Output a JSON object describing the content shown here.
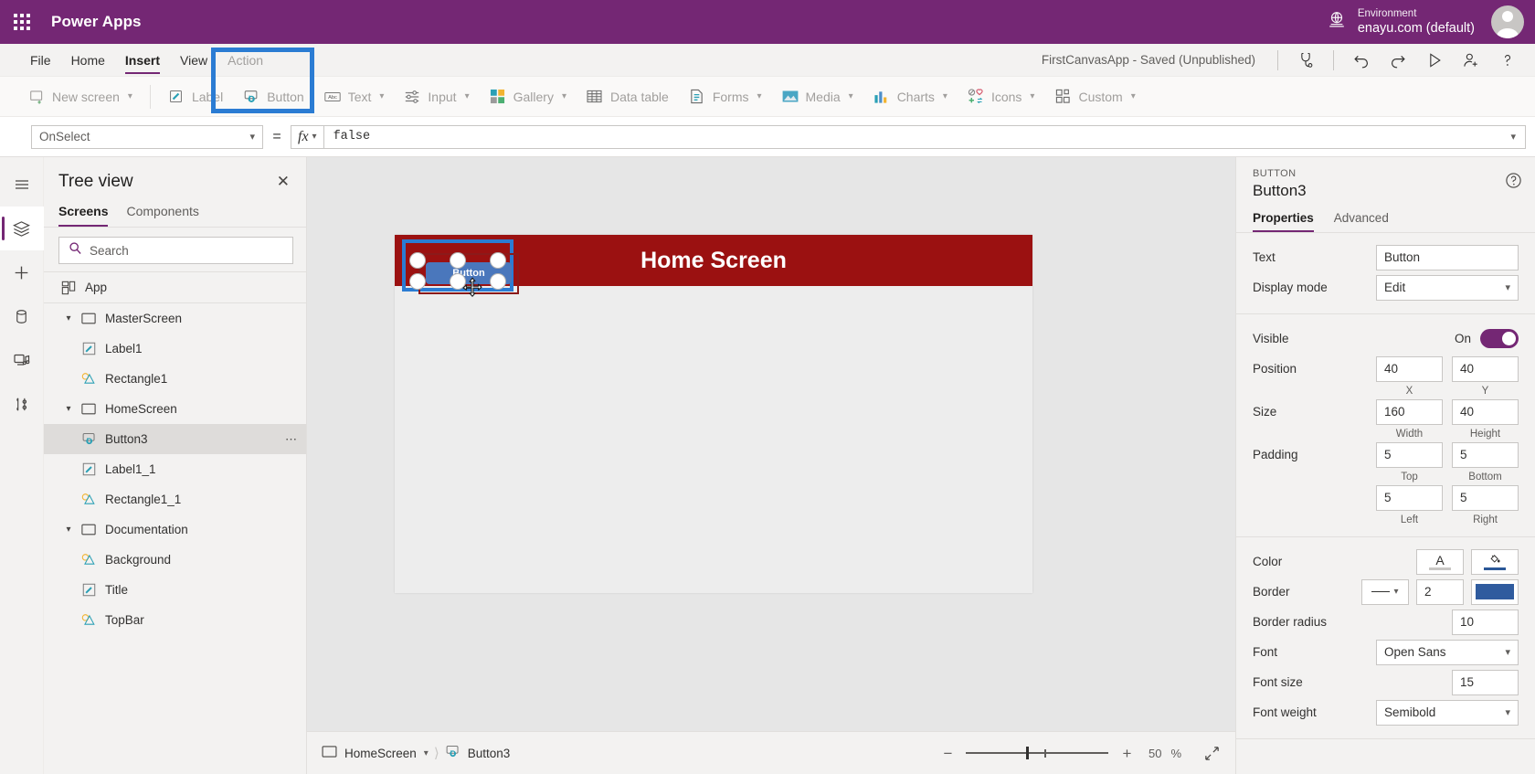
{
  "suite": {
    "waffle_icon": "waffle-icon",
    "brand": "Power Apps",
    "globe_icon": "globe-icon",
    "environment_label": "Environment",
    "environment_value": "enayu.com (default)",
    "avatar_icon": "avatar"
  },
  "menu": {
    "items": [
      {
        "label": "File",
        "active": false,
        "dim": false
      },
      {
        "label": "Home",
        "active": false,
        "dim": false
      },
      {
        "label": "Insert",
        "active": true,
        "dim": false
      },
      {
        "label": "View",
        "active": false,
        "dim": false
      },
      {
        "label": "Action",
        "active": false,
        "dim": true
      }
    ],
    "saved_status": "FirstCanvasApp - Saved (Unpublished)",
    "commands": [
      {
        "name": "app-checker-icon",
        "title": "App checker"
      },
      {
        "name": "undo-icon",
        "title": "Undo"
      },
      {
        "name": "redo-icon",
        "title": "Redo"
      },
      {
        "name": "preview-icon",
        "title": "Preview the app"
      },
      {
        "name": "share-icon",
        "title": "Share"
      },
      {
        "name": "help-icon",
        "title": "Help"
      }
    ]
  },
  "ribbon": {
    "items": [
      {
        "label": "New screen",
        "icon": "new-screen-icon",
        "caret": true
      },
      {
        "label": "Label",
        "icon": "label-icon",
        "caret": false
      },
      {
        "label": "Button",
        "icon": "button-icon",
        "caret": false
      },
      {
        "label": "Text",
        "icon": "text-icon",
        "caret": true
      },
      {
        "label": "Input",
        "icon": "input-icon",
        "caret": true
      },
      {
        "label": "Gallery",
        "icon": "gallery-icon",
        "caret": true
      },
      {
        "label": "Data table",
        "icon": "data-table-icon",
        "caret": false
      },
      {
        "label": "Forms",
        "icon": "forms-icon",
        "caret": true
      },
      {
        "label": "Media",
        "icon": "media-icon",
        "caret": true
      },
      {
        "label": "Charts",
        "icon": "charts-icon",
        "caret": true
      },
      {
        "label": "Icons",
        "icon": "icons-icon",
        "caret": true
      },
      {
        "label": "Custom",
        "icon": "custom-icon",
        "caret": true
      }
    ],
    "highlight_color": "#2b7cd3"
  },
  "formula": {
    "property": "OnSelect",
    "equals": "=",
    "fx_label": "fx",
    "value": "false"
  },
  "rail": {
    "items": [
      {
        "name": "hamburger-icon",
        "selected": false
      },
      {
        "name": "tree-view-icon",
        "selected": true
      },
      {
        "name": "insert-icon",
        "selected": false
      },
      {
        "name": "data-icon",
        "selected": false
      },
      {
        "name": "media-icon",
        "selected": false
      },
      {
        "name": "advanced-tools-icon",
        "selected": false
      }
    ]
  },
  "tree": {
    "title": "Tree view",
    "close_icon": "close-icon",
    "tabs": [
      {
        "label": "Screens",
        "active": true
      },
      {
        "label": "Components",
        "active": false
      }
    ],
    "search_placeholder": "Search",
    "search_icon": "search-icon",
    "app_label": "App",
    "app_icon": "app-icon",
    "nodes": [
      {
        "label": "MasterScreen",
        "icon": "screen-icon",
        "indent": 0,
        "caret": "expanded",
        "selected": false,
        "menu": false
      },
      {
        "label": "Label1",
        "icon": "label-icon",
        "indent": 1,
        "caret": "none",
        "selected": false,
        "menu": false
      },
      {
        "label": "Rectangle1",
        "icon": "shape-icon",
        "indent": 1,
        "caret": "none",
        "selected": false,
        "menu": false
      },
      {
        "label": "HomeScreen",
        "icon": "screen-icon",
        "indent": 0,
        "caret": "expanded",
        "selected": false,
        "menu": false
      },
      {
        "label": "Button3",
        "icon": "button-icon",
        "indent": 1,
        "caret": "none",
        "selected": true,
        "menu": true
      },
      {
        "label": "Label1_1",
        "icon": "label-icon",
        "indent": 1,
        "caret": "none",
        "selected": false,
        "menu": false
      },
      {
        "label": "Rectangle1_1",
        "icon": "shape-icon",
        "indent": 1,
        "caret": "none",
        "selected": false,
        "menu": false
      },
      {
        "label": "Documentation",
        "icon": "screen-icon",
        "indent": 0,
        "caret": "expanded",
        "selected": false,
        "menu": false
      },
      {
        "label": "Background",
        "icon": "shape-icon",
        "indent": 1,
        "caret": "none",
        "selected": false,
        "menu": false
      },
      {
        "label": "Title",
        "icon": "label-icon",
        "indent": 1,
        "caret": "none",
        "selected": false,
        "menu": false
      },
      {
        "label": "TopBar",
        "icon": "shape-icon",
        "indent": 1,
        "caret": "none",
        "selected": false,
        "menu": false
      }
    ],
    "node_menu_icon": "ellipsis-icon"
  },
  "canvas": {
    "screen_title": "Home Screen",
    "topbar_color": "#9b1111",
    "screen_bg": "#ededed",
    "button_text": "Button",
    "button_fill": "#4a77bc",
    "selection_color": "#2b7cd3",
    "cursor_icon": "move-cursor-icon"
  },
  "status": {
    "screen_name": "HomeScreen",
    "screen_icon": "screen-icon",
    "control_name": "Button3",
    "control_icon": "button-icon",
    "zoom_out_icon": "minus-icon",
    "zoom_in_icon": "plus-icon",
    "zoom_value": "50",
    "zoom_unit": "%",
    "fit_icon": "fit-to-screen-icon"
  },
  "properties": {
    "kicker": "BUTTON",
    "name": "Button3",
    "help_icon": "help-circle-icon",
    "tabs": [
      {
        "label": "Properties",
        "active": true
      },
      {
        "label": "Advanced",
        "active": false
      }
    ],
    "text_label": "Text",
    "text_value": "Button",
    "display_mode_label": "Display mode",
    "display_mode_value": "Edit",
    "visible_label": "Visible",
    "visible_state": "On",
    "position_label": "Position",
    "position_x": "40",
    "position_y": "40",
    "position_x_sub": "X",
    "position_y_sub": "Y",
    "size_label": "Size",
    "size_width": "160",
    "size_height": "40",
    "size_width_sub": "Width",
    "size_height_sub": "Height",
    "padding_label": "Padding",
    "padding_top": "5",
    "padding_bottom": "5",
    "padding_left": "5",
    "padding_right": "5",
    "padding_top_sub": "Top",
    "padding_bottom_sub": "Bottom",
    "padding_left_sub": "Left",
    "padding_right_sub": "Right",
    "color_label": "Color",
    "color_text_glyph": "A",
    "color_text_swatch": "#c8c6c4",
    "color_fill_glyph": "fill-icon",
    "color_fill_swatch": "#2b5797",
    "border_label": "Border",
    "border_width": "2",
    "border_color": "#2f5b9e",
    "border_radius_label": "Border radius",
    "border_radius_value": "10",
    "font_label": "Font",
    "font_value": "Open Sans",
    "font_size_label": "Font size",
    "font_size_value": "15",
    "font_weight_label": "Font weight",
    "font_weight_value": "Semibold"
  }
}
